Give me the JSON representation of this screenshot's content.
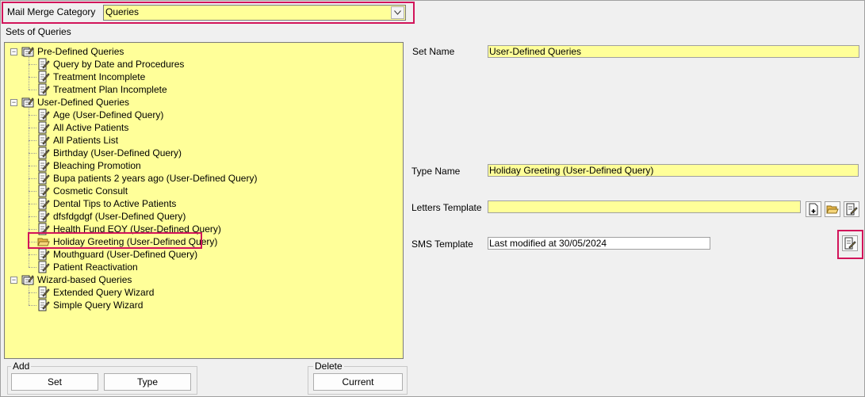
{
  "category": {
    "label": "Mail Merge Category",
    "value": "Queries"
  },
  "sets_label": "Sets of Queries",
  "tree": [
    {
      "label": "Pre-Defined Queries",
      "children": [
        {
          "label": "Query by Date and Procedures"
        },
        {
          "label": "Treatment Incomplete"
        },
        {
          "label": "Treatment Plan Incomplete"
        }
      ]
    },
    {
      "label": "User-Defined Queries",
      "children": [
        {
          "label": "Age (User-Defined Query)"
        },
        {
          "label": "All Active Patients"
        },
        {
          "label": "All Patients List"
        },
        {
          "label": "Birthday (User-Defined Query)"
        },
        {
          "label": "Bleaching Promotion"
        },
        {
          "label": "Bupa patients 2 years ago (User-Defined Query)"
        },
        {
          "label": "Cosmetic Consult"
        },
        {
          "label": "Dental Tips to Active Patients"
        },
        {
          "label": "dfsfdgdgf (User-Defined Query)"
        },
        {
          "label": "Health Fund EOY (User-Defined Query)"
        },
        {
          "label": "Holiday Greeting (User-Defined Query)",
          "selected": true
        },
        {
          "label": "Mouthguard (User-Defined Query)"
        },
        {
          "label": "Patient Reactivation"
        }
      ]
    },
    {
      "label": "Wizard-based Queries",
      "children": [
        {
          "label": "Extended Query Wizard"
        },
        {
          "label": "Simple Query Wizard"
        }
      ]
    }
  ],
  "form": {
    "set_name_label": "Set Name",
    "set_name_value": "User-Defined Queries",
    "type_name_label": "Type Name",
    "type_name_value": "Holiday Greeting (User-Defined Query)",
    "letters_label": "Letters Template",
    "letters_value": "",
    "sms_label": "SMS Template",
    "sms_value": "Last modified at 30/05/2024"
  },
  "add_group": {
    "label": "Add",
    "set_button": "Set",
    "type_button": "Type"
  },
  "delete_group": {
    "label": "Delete",
    "current_button": "Current"
  },
  "colors": {
    "field_bg": "#ffff99",
    "highlight": "#d2145a"
  }
}
